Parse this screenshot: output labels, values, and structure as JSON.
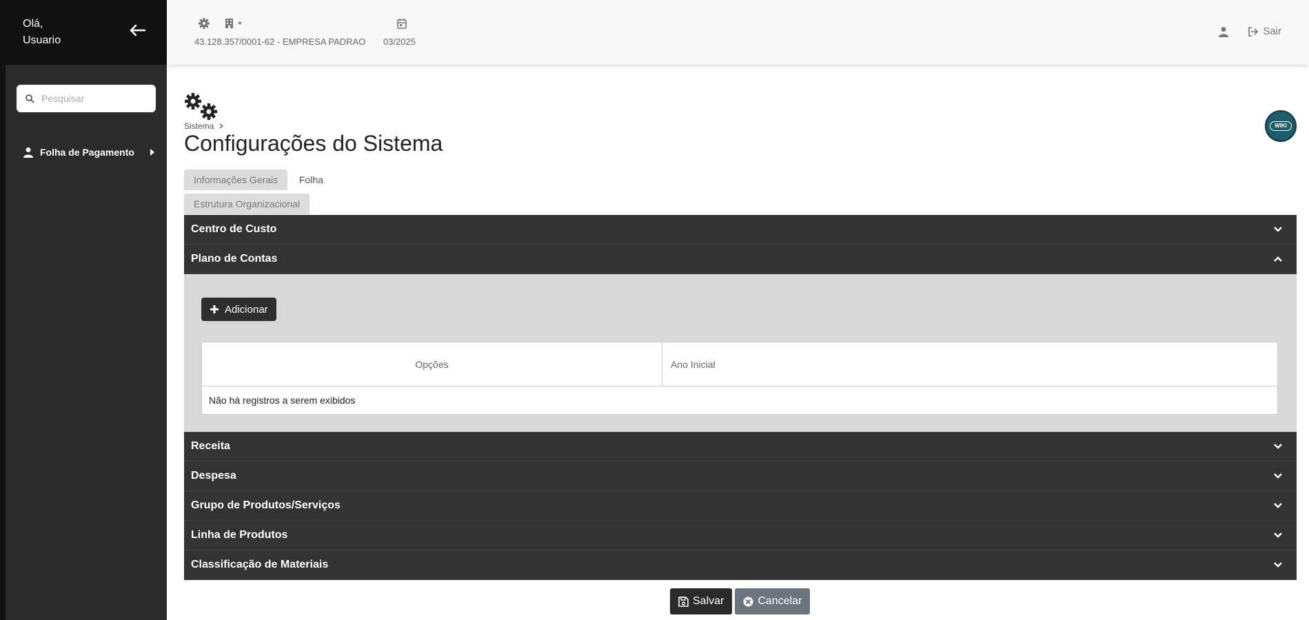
{
  "sidebar": {
    "greeting_line1": "Olá,",
    "greeting_line2": "Usuario",
    "search_placeholder": "Pesquisar",
    "items": [
      {
        "label": "Folha de Pagamento",
        "icon": "user-icon"
      }
    ]
  },
  "topbar": {
    "company": "43.128.357/0001-62 - EMPRESA PADRAO",
    "period": "03/2025",
    "exit_label": "Sair"
  },
  "page": {
    "breadcrumb": "Sistema",
    "title": "Configurações do Sistema",
    "wiki_label": "WIKI"
  },
  "tabs": [
    {
      "label": "Informações Gerais"
    },
    {
      "label": "Folha"
    },
    {
      "label": "Estrutura Organizacional"
    }
  ],
  "accordion": {
    "sections": [
      {
        "label": "Centro de Custo",
        "expanded": false
      },
      {
        "label": "Plano de Contas",
        "expanded": true
      },
      {
        "label": "Receita",
        "expanded": false
      },
      {
        "label": "Despesa",
        "expanded": false
      },
      {
        "label": "Grupo de Produtos/Serviços",
        "expanded": false
      },
      {
        "label": "Linha de Produtos",
        "expanded": false
      },
      {
        "label": "Classificação de Materiais",
        "expanded": false
      }
    ],
    "add_label": "Adicionar",
    "table": {
      "columns": [
        "Opções",
        "Ano Inicial"
      ],
      "empty_message": "Não há registros a serem exibidos"
    }
  },
  "actions": {
    "save_label": "Salvar",
    "cancel_label": "Cancelar"
  },
  "colors": {
    "sidebar": "#2b2b2b",
    "sidebar_head": "#111111",
    "accordion_header": "#333333",
    "accordion_body": "#d8d8d8",
    "wiki": "#1e5c6b",
    "cancel": "#6c757d"
  }
}
